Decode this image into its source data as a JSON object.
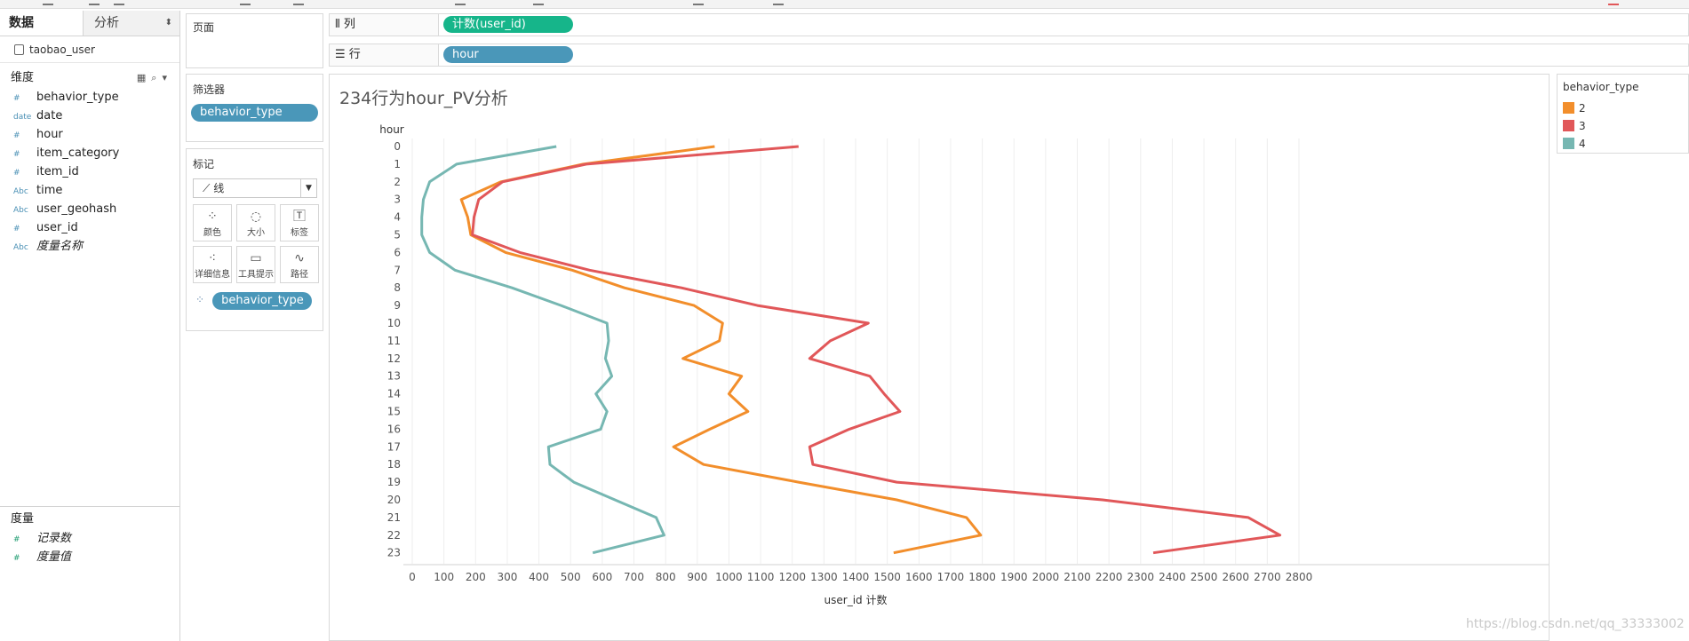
{
  "left_panel": {
    "tab_data": "数据",
    "tab_analysis": "分析",
    "datasource": "taobao_user",
    "dimensions_label": "维度",
    "dimensions": [
      {
        "type": "#",
        "name": "behavior_type"
      },
      {
        "type": "date",
        "name": "date"
      },
      {
        "type": "#",
        "name": "hour"
      },
      {
        "type": "#",
        "name": "item_category"
      },
      {
        "type": "#",
        "name": "item_id"
      },
      {
        "type": "Abc",
        "name": "time"
      },
      {
        "type": "Abc",
        "name": "user_geohash"
      },
      {
        "type": "#",
        "name": "user_id"
      },
      {
        "type": "Abc",
        "name": "度量名称"
      }
    ],
    "measures_label": "度量",
    "measures": [
      {
        "type": "#",
        "name": "记录数"
      },
      {
        "type": "#",
        "name": "度量值"
      }
    ]
  },
  "pages_card": {
    "title": "页面"
  },
  "filters_card": {
    "title": "筛选器",
    "pill": "behavior_type"
  },
  "marks_card": {
    "title": "标记",
    "mark_type": "线",
    "buttons": [
      {
        "icon": "color-icon",
        "label": "颜色"
      },
      {
        "icon": "size-icon",
        "label": "大小"
      },
      {
        "icon": "label-icon",
        "label": "标签"
      },
      {
        "icon": "detail-icon",
        "label": "详细信息"
      },
      {
        "icon": "tooltip-icon",
        "label": "工具提示"
      },
      {
        "icon": "path-icon",
        "label": "路径"
      }
    ],
    "color_pill": "behavior_type"
  },
  "columns_shelf": {
    "label": "列",
    "pill": "计数(user_id)"
  },
  "rows_shelf": {
    "label": "行",
    "pill": "hour"
  },
  "view": {
    "title": "234行为hour_PV分析"
  },
  "legend": {
    "title": "behavior_type",
    "items": [
      {
        "label": "2",
        "color": "#f28e2b"
      },
      {
        "label": "3",
        "color": "#e15759"
      },
      {
        "label": "4",
        "color": "#76b7b2"
      }
    ]
  },
  "watermark": "https://blog.csdn.net/qq_33333002",
  "chart_data": {
    "type": "line",
    "orientation": "horizontal",
    "title": "234行为hour_PV分析",
    "xlabel": "user_id 计数",
    "ylabel": "hour",
    "xlim": [
      0,
      2800
    ],
    "xticks": [
      0,
      100,
      200,
      300,
      400,
      500,
      600,
      700,
      800,
      900,
      1000,
      1100,
      1200,
      1300,
      1400,
      1500,
      1600,
      1700,
      1800,
      1900,
      2000,
      2100,
      2200,
      2300,
      2400,
      2500,
      2600,
      2700,
      2800
    ],
    "hours": [
      0,
      1,
      2,
      3,
      4,
      5,
      6,
      7,
      8,
      9,
      10,
      11,
      12,
      13,
      14,
      15,
      16,
      17,
      18,
      19,
      20,
      21,
      22,
      23
    ],
    "grid": "vertical",
    "legend_position": "right",
    "series": [
      {
        "name": "2",
        "color": "#f28e2b",
        "values": [
          955,
          540,
          280,
          155,
          175,
          185,
          295,
          505,
          670,
          890,
          980,
          970,
          855,
          1040,
          1000,
          1060,
          940,
          825,
          920,
          1220,
          1530,
          1750,
          1795,
          1520
        ]
      },
      {
        "name": "3",
        "color": "#e15759",
        "values": [
          1220,
          550,
          285,
          210,
          195,
          190,
          340,
          560,
          850,
          1090,
          1440,
          1320,
          1255,
          1445,
          1490,
          1540,
          1380,
          1255,
          1265,
          1530,
          2180,
          2640,
          2740,
          2340
        ]
      },
      {
        "name": "4",
        "color": "#76b7b2",
        "values": [
          455,
          140,
          55,
          35,
          30,
          30,
          55,
          135,
          315,
          470,
          615,
          620,
          610,
          630,
          580,
          615,
          595,
          430,
          435,
          510,
          640,
          770,
          795,
          570
        ]
      }
    ]
  }
}
